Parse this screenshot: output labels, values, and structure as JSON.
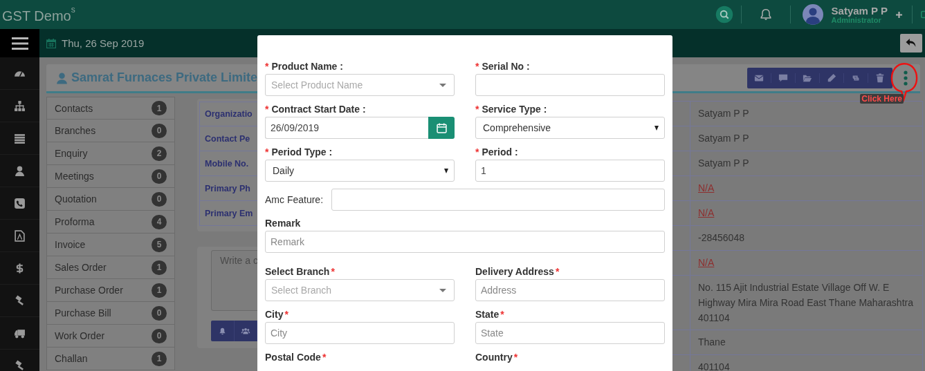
{
  "app": {
    "logo": "GST Demo$^{s}$"
  },
  "user": {
    "name": "Satyam P P",
    "role": "Administrator"
  },
  "date": "Thu, 26 Sep 2019",
  "company": {
    "name": "Samrat Furnaces Private Limite"
  },
  "annotation": {
    "text": "Click Here"
  },
  "nav_items": [
    {
      "label": "Contacts",
      "count": "1"
    },
    {
      "label": "Branches",
      "count": "0"
    },
    {
      "label": "Enquiry",
      "count": "2"
    },
    {
      "label": "Meetings",
      "count": "0"
    },
    {
      "label": "Quotation",
      "count": "0"
    },
    {
      "label": "Proforma",
      "count": "4"
    },
    {
      "label": "Invoice",
      "count": "5"
    },
    {
      "label": "Sales Order",
      "count": "1"
    },
    {
      "label": "Purchase Order",
      "count": "1"
    },
    {
      "label": "Purchase Bill",
      "count": "0"
    },
    {
      "label": "Work Order",
      "count": "0"
    },
    {
      "label": "Challan",
      "count": "1"
    }
  ],
  "details": {
    "labels": [
      "Organizatio",
      "Contact Pe",
      "Mobile No.",
      "Primary Ph",
      "Primary Em"
    ]
  },
  "info_values": [
    {
      "text": "Satyam P P",
      "kind": "text"
    },
    {
      "text": "Satyam P P",
      "kind": "text"
    },
    {
      "text": "Satyam P P",
      "kind": "text"
    },
    {
      "text": "N/A",
      "kind": "link"
    },
    {
      "text": "N/A",
      "kind": "link"
    },
    {
      "text": "-28456048",
      "kind": "text"
    },
    {
      "text": "N/A",
      "kind": "link"
    },
    {
      "text": "No. 115 Ajit Industrial Estate Village Off W. E Highway Mira Mira Road East Thane Maharashtra 401104",
      "kind": "text"
    },
    {
      "text": "Thane",
      "kind": "text"
    },
    {
      "text": "401104",
      "kind": "text"
    }
  ],
  "comment": {
    "placeholder": "Write a c"
  },
  "modal": {
    "rows": [
      {
        "fields": [
          {
            "label": "Product Name :",
            "star_before": "*",
            "kind": "select2",
            "placeholder": "Select Product Name"
          },
          {
            "label": "Serial No :",
            "star_before": "*",
            "kind": "input"
          }
        ]
      },
      {
        "fields": [
          {
            "label": "Contract Start Date :",
            "star_before": "*",
            "kind": "date",
            "value": "26/09/2019"
          },
          {
            "label": "Service Type :",
            "star_before": "*",
            "kind": "select",
            "value": "Comprehensive"
          }
        ]
      },
      {
        "fields": [
          {
            "label": "Period Type :",
            "star_before": "*",
            "kind": "select",
            "value": "Daily"
          },
          {
            "label": "Period :",
            "star_before": "*",
            "kind": "input",
            "value": "1"
          }
        ]
      },
      {
        "fields": [
          {
            "label": "Amc Feature:",
            "kind": "inline"
          }
        ]
      },
      {
        "fields": [
          {
            "label": "Remark",
            "kind": "input",
            "placeholder": "Remark"
          }
        ]
      },
      {
        "fields": [
          {
            "label": "Select Branch",
            "star_after": "*",
            "kind": "select2",
            "placeholder": "Select Branch"
          },
          {
            "label": "Delivery Address",
            "star_after": "*",
            "kind": "input",
            "placeholder": "Address"
          }
        ]
      },
      {
        "fields": [
          {
            "label": "City",
            "star_after": "*",
            "kind": "input",
            "placeholder": "City"
          },
          {
            "label": "State",
            "star_after": "*",
            "kind": "input",
            "placeholder": "State"
          }
        ]
      },
      {
        "fields": [
          {
            "label": "Postal Code",
            "star_after": "*"
          },
          {
            "label": "Country",
            "star_after": "*"
          }
        ]
      }
    ]
  }
}
